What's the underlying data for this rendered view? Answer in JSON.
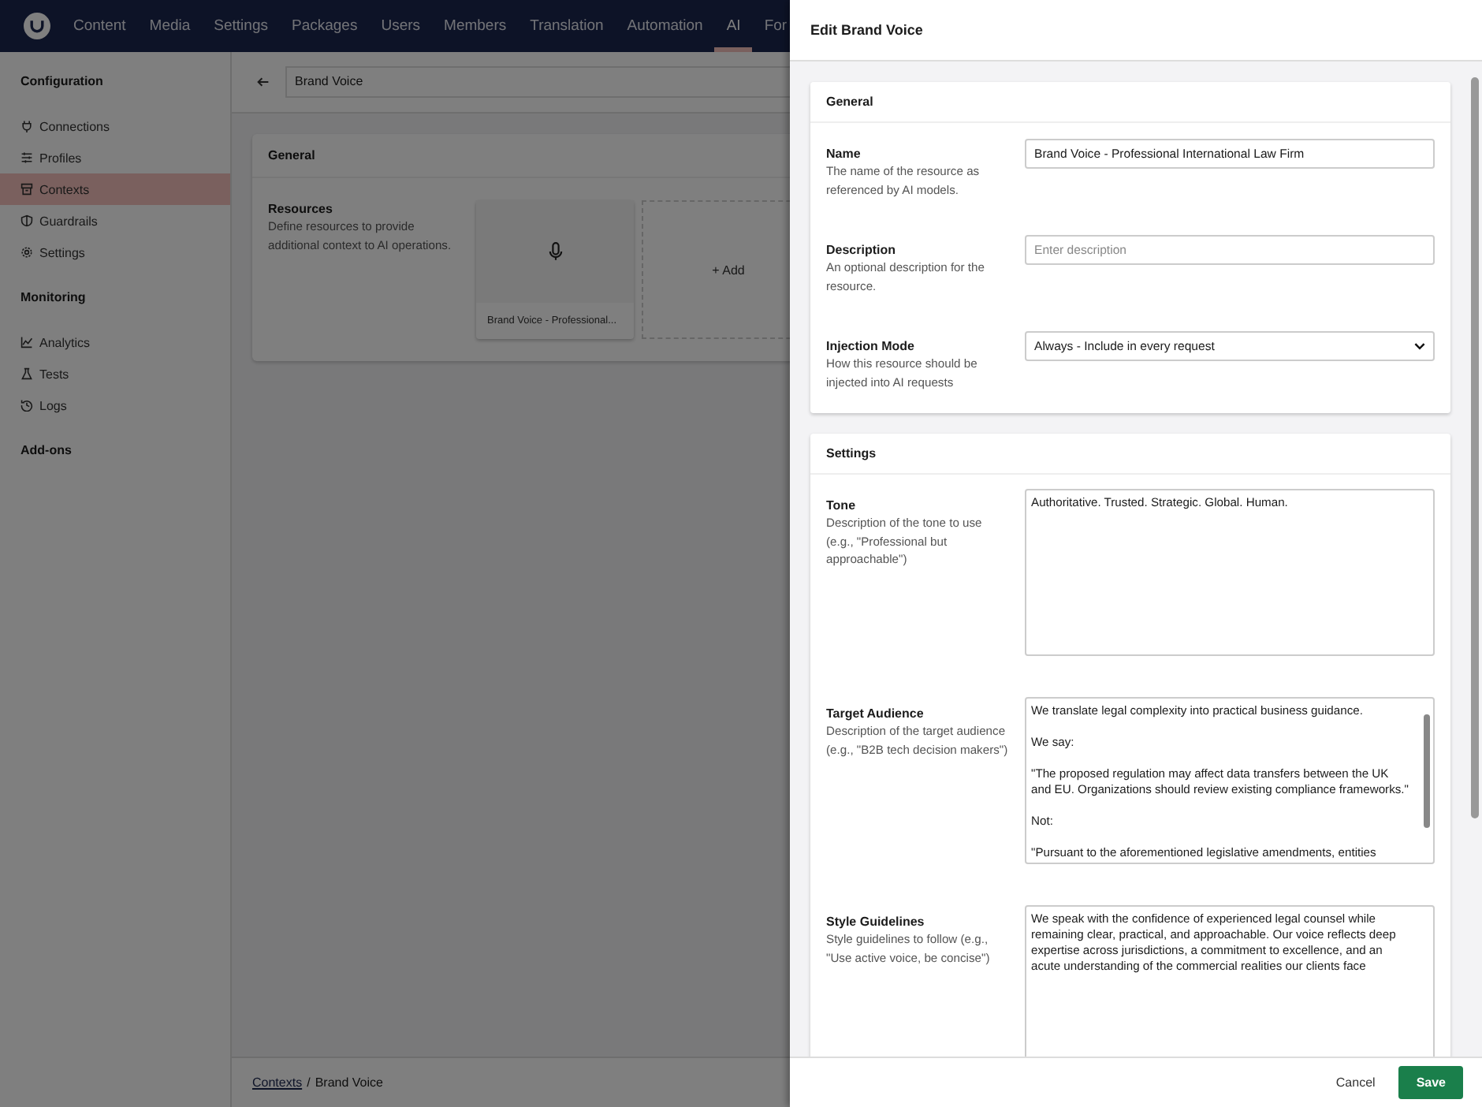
{
  "top_nav": {
    "items": [
      {
        "label": "Content",
        "selected": false
      },
      {
        "label": "Media",
        "selected": false
      },
      {
        "label": "Settings",
        "selected": false
      },
      {
        "label": "Packages",
        "selected": false
      },
      {
        "label": "Users",
        "selected": false
      },
      {
        "label": "Members",
        "selected": false
      },
      {
        "label": "Translation",
        "selected": false
      },
      {
        "label": "Automation",
        "selected": false
      },
      {
        "label": "AI",
        "selected": true
      },
      {
        "label": "For",
        "selected": false
      }
    ]
  },
  "sidebar": {
    "sections": [
      {
        "title": "Configuration",
        "items": [
          {
            "label": "Connections",
            "selected": false
          },
          {
            "label": "Profiles",
            "selected": false
          },
          {
            "label": "Contexts",
            "selected": true
          },
          {
            "label": "Guardrails",
            "selected": false
          },
          {
            "label": "Settings",
            "selected": false
          }
        ]
      },
      {
        "title": "Monitoring",
        "items": [
          {
            "label": "Analytics",
            "selected": false
          },
          {
            "label": "Tests",
            "selected": false
          },
          {
            "label": "Logs",
            "selected": false
          }
        ]
      },
      {
        "title": "Add-ons"
      }
    ]
  },
  "header": {
    "title_value": "Brand Voice"
  },
  "main_card": {
    "title": "General",
    "resources": {
      "label": "Resources",
      "description": "Define resources to provide additional context to AI operations.",
      "items": [
        {
          "label": "Brand Voice - Professional..."
        }
      ],
      "add_label": "+ Add"
    }
  },
  "breadcrumb": {
    "link": "Contexts",
    "separator": "/",
    "current": "Brand Voice"
  },
  "panel": {
    "title": "Edit Brand Voice",
    "sections": [
      {
        "title": "General",
        "fields": [
          {
            "kind": "input",
            "label": "Name",
            "description": "The name of the resource as referenced by AI models.",
            "value": "Brand Voice - Professional International Law Firm"
          },
          {
            "kind": "input",
            "label": "Description",
            "description": "An optional description for the resource.",
            "placeholder": "Enter description"
          },
          {
            "kind": "select",
            "label": "Injection Mode",
            "description": "How this resource should be injected into AI requests",
            "value": "Always - Include in every request"
          }
        ]
      },
      {
        "title": "Settings",
        "fields": [
          {
            "kind": "textarea",
            "label": "Tone",
            "description": "Description of the tone to use (e.g., \"Professional but approachable\")",
            "value": "Authoritative. Trusted. Strategic. Global. Human."
          },
          {
            "kind": "scrolling_textarea",
            "label": "Target Audience",
            "description": "Description of the target audience (e.g., \"B2B tech decision makers\")",
            "value": "We translate legal complexity into practical business guidance.\n\nWe say:\n\n\"The proposed regulation may affect data transfers between the UK and EU. Organizations should review existing compliance frameworks.\"\n\nNot:\n\n\"Pursuant to the aforementioned legislative amendments, entities"
          },
          {
            "kind": "textarea",
            "label": "Style Guidelines",
            "description": "Style guidelines to follow (e.g., \"Use active voice, be concise\")",
            "value": "We speak with the confidence of experienced legal counsel while remaining clear, practical, and approachable. Our voice reflects deep expertise across jurisdictions, a commitment to excellence, and an acute understanding of the commercial realities our clients face"
          }
        ]
      }
    ],
    "cancel": "Cancel",
    "save": "Save"
  }
}
